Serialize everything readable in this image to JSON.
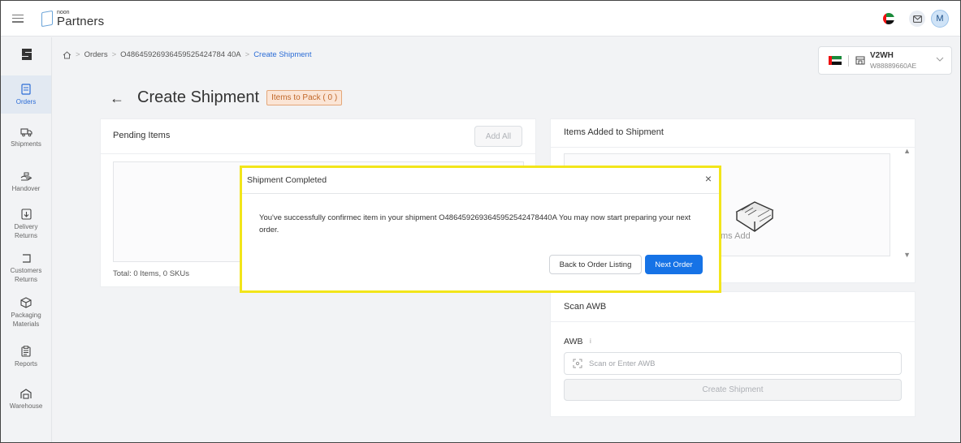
{
  "app": {
    "logo_small": "noon",
    "logo_big": "Partners",
    "avatar_letter": "M"
  },
  "sidebar": {
    "items": [
      {
        "label": "Orders",
        "icon": "orders-icon"
      },
      {
        "label": "Shipments",
        "icon": "truck-icon"
      },
      {
        "label": "Handover",
        "icon": "handover-icon"
      },
      {
        "label": "Delivery Returns",
        "icon": "delivery-returns-icon"
      },
      {
        "label": "Customers Returns",
        "icon": "customer-returns-icon"
      },
      {
        "label": "Packaging Materials",
        "icon": "package-icon"
      },
      {
        "label": "Reports",
        "icon": "reports-icon"
      },
      {
        "label": "Warehouse",
        "icon": "warehouse-icon"
      }
    ]
  },
  "breadcrumb": {
    "orders": "Orders",
    "order_id": "O48645926936459525424784 40A",
    "current": "Create Shipment"
  },
  "warehouse": {
    "name": "V2WH",
    "code": "W88889660AE"
  },
  "page": {
    "title": "Create Shipment",
    "badge": "Items to Pack ( 0 )"
  },
  "pending": {
    "title": "Pending Items",
    "add_all": "Add All",
    "total": "Total: 0 Items, 0 SKUs"
  },
  "added": {
    "title": "Items Added to Shipment",
    "empty_text": "ms Add"
  },
  "awb": {
    "title": "Scan AWB",
    "label": "AWB",
    "placeholder": "Scan or Enter AWB",
    "create_button": "Create Shipment"
  },
  "modal": {
    "title": "Shipment Completed",
    "message": "You've successfully confirmec    item in your shipment O4864592693645952542478440A You may now start preparing your next order.",
    "back_button": "Back to Order Listing",
    "next_button": "Next Order"
  },
  "colors": {
    "accent": "#1673e6",
    "highlight": "#f2e51a",
    "badge_text": "#c1692a"
  }
}
